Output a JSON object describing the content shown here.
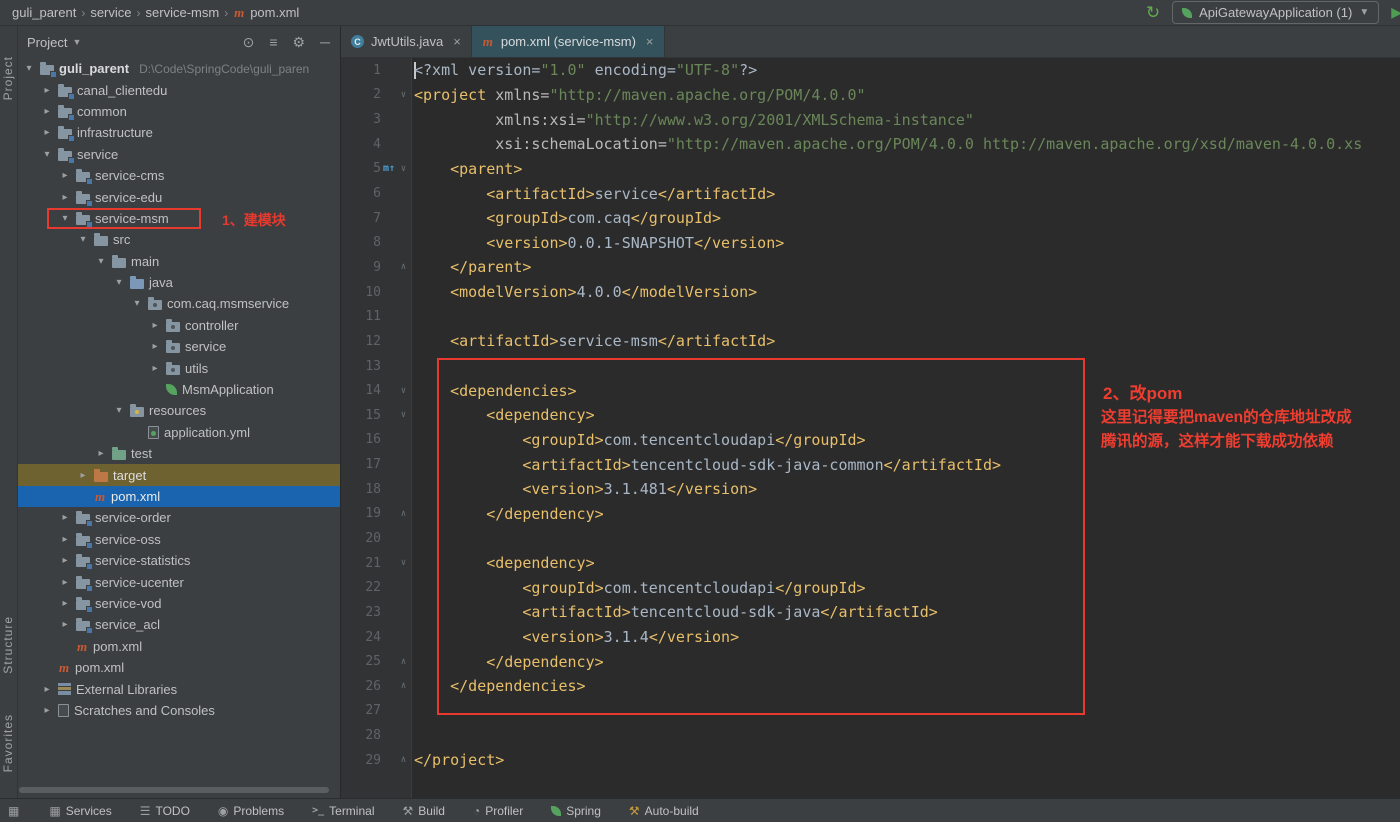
{
  "breadcrumbs": {
    "items": [
      {
        "label": "guli_parent"
      },
      {
        "label": "service"
      },
      {
        "label": "service-msm"
      },
      {
        "label": "pom.xml",
        "icon": "maven"
      }
    ]
  },
  "run": {
    "config": "ApiGatewayApplication (1)"
  },
  "stripe": {
    "project": "Project",
    "structure": "Structure",
    "favorites": "Favorites"
  },
  "panel": {
    "title": "Project",
    "toolbar_icons": [
      "locate",
      "collapse-all",
      "settings",
      "hide"
    ]
  },
  "tabs": [
    {
      "label": "JwtUtils.java",
      "icon": "java-class",
      "active": false
    },
    {
      "label": "pom.xml (service-msm)",
      "icon": "maven",
      "active": true
    }
  ],
  "tree": [
    {
      "label": "guli_parent",
      "path": "D:\\Code\\SpringCode\\guli_paren",
      "lv": 0,
      "ch": "open",
      "icon": "module",
      "bold": true
    },
    {
      "label": "canal_clientedu",
      "lv": 1,
      "ch": "closed",
      "icon": "module"
    },
    {
      "label": "common",
      "lv": 1,
      "ch": "closed",
      "icon": "module"
    },
    {
      "label": "infrastructure",
      "lv": 1,
      "ch": "closed",
      "icon": "module"
    },
    {
      "label": "service",
      "lv": 1,
      "ch": "open",
      "icon": "module"
    },
    {
      "label": "service-cms",
      "lv": 2,
      "ch": "closed",
      "icon": "module"
    },
    {
      "label": "service-edu",
      "lv": 2,
      "ch": "closed",
      "icon": "module"
    },
    {
      "label": "service-msm",
      "lv": 2,
      "ch": "open",
      "icon": "module",
      "box": true,
      "note": "1、建模块"
    },
    {
      "label": "src",
      "lv": 3,
      "ch": "open",
      "icon": "folder"
    },
    {
      "label": "main",
      "lv": 4,
      "ch": "open",
      "icon": "folder"
    },
    {
      "label": "java",
      "lv": 5,
      "ch": "open",
      "icon": "folder-src"
    },
    {
      "label": "com.caq.msmservice",
      "lv": 6,
      "ch": "open",
      "icon": "package"
    },
    {
      "label": "controller",
      "lv": 7,
      "ch": "closed",
      "icon": "package"
    },
    {
      "label": "service",
      "lv": 7,
      "ch": "closed",
      "icon": "package"
    },
    {
      "label": "utils",
      "lv": 7,
      "ch": "closed",
      "icon": "package"
    },
    {
      "label": "MsmApplication",
      "lv": 7,
      "ch": "",
      "icon": "spring-class"
    },
    {
      "label": "resources",
      "lv": 5,
      "ch": "open",
      "icon": "folder-res"
    },
    {
      "label": "application.yml",
      "lv": 6,
      "ch": "",
      "icon": "yml"
    },
    {
      "label": "test",
      "lv": 4,
      "ch": "closed",
      "icon": "folder-test"
    },
    {
      "label": "target",
      "lv": 3,
      "ch": "closed",
      "icon": "folder-target",
      "sel": "amber"
    },
    {
      "label": "pom.xml",
      "lv": 3,
      "ch": "",
      "icon": "maven",
      "sel": "blue"
    },
    {
      "label": "service-order",
      "lv": 2,
      "ch": "closed",
      "icon": "module"
    },
    {
      "label": "service-oss",
      "lv": 2,
      "ch": "closed",
      "icon": "module"
    },
    {
      "label": "service-statistics",
      "lv": 2,
      "ch": "closed",
      "icon": "module"
    },
    {
      "label": "service-ucenter",
      "lv": 2,
      "ch": "closed",
      "icon": "module"
    },
    {
      "label": "service-vod",
      "lv": 2,
      "ch": "closed",
      "icon": "module"
    },
    {
      "label": "service_acl",
      "lv": 2,
      "ch": "closed",
      "icon": "module"
    },
    {
      "label": "pom.xml",
      "lv": 2,
      "ch": "",
      "icon": "maven"
    },
    {
      "label": "pom.xml",
      "lv": 1,
      "ch": "",
      "icon": "maven"
    },
    {
      "label": "External Libraries",
      "lv": 1,
      "ch": "closed",
      "icon": "lib"
    },
    {
      "label": "Scratches and Consoles",
      "lv": 1,
      "ch": "closed",
      "icon": "scratch"
    }
  ],
  "editor": {
    "lines": [
      {
        "f": "",
        "b": false,
        "c": true,
        "t": [
          [
            "p",
            "<?xml version="
          ],
          [
            "s",
            "\"1.0\""
          ],
          [
            "p",
            " encoding="
          ],
          [
            "s",
            "\"UTF-8\""
          ],
          [
            "p",
            "?>"
          ]
        ]
      },
      {
        "f": "v",
        "b": false,
        "t": [
          [
            "t",
            "<project"
          ],
          [
            "p",
            " "
          ],
          [
            "a",
            "xmlns="
          ],
          [
            "s",
            "\"http://maven.apache.org/POM/4.0.0\""
          ]
        ]
      },
      {
        "f": "",
        "b": false,
        "t": [
          [
            "p",
            "         "
          ],
          [
            "a",
            "xmlns:xsi="
          ],
          [
            "s",
            "\"http://www.w3.org/2001/XMLSchema-instance\""
          ]
        ]
      },
      {
        "f": "",
        "b": false,
        "t": [
          [
            "p",
            "         "
          ],
          [
            "a",
            "xsi:schemaLocation="
          ],
          [
            "s",
            "\"http://maven.apache.org/POM/4.0.0 http://maven.apache.org/xsd/maven-4.0.0.xs"
          ]
        ]
      },
      {
        "f": "v",
        "b": true,
        "t": [
          [
            "p",
            "    "
          ],
          [
            "t",
            "<parent>"
          ]
        ]
      },
      {
        "f": "",
        "b": false,
        "t": [
          [
            "p",
            "        "
          ],
          [
            "t",
            "<artifactId>"
          ],
          [
            "p",
            "service"
          ],
          [
            "t",
            "</artifactId>"
          ]
        ]
      },
      {
        "f": "",
        "b": false,
        "t": [
          [
            "p",
            "        "
          ],
          [
            "t",
            "<groupId>"
          ],
          [
            "p",
            "com.caq"
          ],
          [
            "t",
            "</groupId>"
          ]
        ]
      },
      {
        "f": "",
        "b": false,
        "t": [
          [
            "p",
            "        "
          ],
          [
            "t",
            "<version>"
          ],
          [
            "p",
            "0.0.1-SNAPSHOT"
          ],
          [
            "t",
            "</version>"
          ]
        ]
      },
      {
        "f": "^",
        "b": false,
        "t": [
          [
            "p",
            "    "
          ],
          [
            "t",
            "</parent>"
          ]
        ]
      },
      {
        "f": "",
        "b": false,
        "t": [
          [
            "p",
            "    "
          ],
          [
            "t",
            "<modelVersion>"
          ],
          [
            "p",
            "4.0.0"
          ],
          [
            "t",
            "</modelVersion>"
          ]
        ]
      },
      {
        "f": "",
        "b": false,
        "t": []
      },
      {
        "f": "",
        "b": false,
        "t": [
          [
            "p",
            "    "
          ],
          [
            "t",
            "<artifactId>"
          ],
          [
            "p",
            "service-msm"
          ],
          [
            "t",
            "</artifactId>"
          ]
        ]
      },
      {
        "f": "",
        "b": false,
        "t": []
      },
      {
        "f": "v",
        "b": false,
        "t": [
          [
            "p",
            "    "
          ],
          [
            "t",
            "<dependencies>"
          ]
        ]
      },
      {
        "f": "v",
        "b": false,
        "t": [
          [
            "p",
            "        "
          ],
          [
            "t",
            "<dependency>"
          ]
        ]
      },
      {
        "f": "",
        "b": false,
        "t": [
          [
            "p",
            "            "
          ],
          [
            "t",
            "<groupId>"
          ],
          [
            "p",
            "com.tencentcloudapi"
          ],
          [
            "t",
            "</groupId>"
          ]
        ]
      },
      {
        "f": "",
        "b": false,
        "t": [
          [
            "p",
            "            "
          ],
          [
            "t",
            "<artifactId>"
          ],
          [
            "p",
            "tencentcloud-sdk-java-common"
          ],
          [
            "t",
            "</artifactId>"
          ]
        ]
      },
      {
        "f": "",
        "b": false,
        "t": [
          [
            "p",
            "            "
          ],
          [
            "t",
            "<version>"
          ],
          [
            "p",
            "3.1.481"
          ],
          [
            "t",
            "</version>"
          ]
        ]
      },
      {
        "f": "^",
        "b": false,
        "t": [
          [
            "p",
            "        "
          ],
          [
            "t",
            "</dependency>"
          ]
        ]
      },
      {
        "f": "",
        "b": false,
        "t": []
      },
      {
        "f": "v",
        "b": false,
        "t": [
          [
            "p",
            "        "
          ],
          [
            "t",
            "<dependency>"
          ]
        ]
      },
      {
        "f": "",
        "b": false,
        "t": [
          [
            "p",
            "            "
          ],
          [
            "t",
            "<groupId>"
          ],
          [
            "p",
            "com.tencentcloudapi"
          ],
          [
            "t",
            "</groupId>"
          ]
        ]
      },
      {
        "f": "",
        "b": false,
        "t": [
          [
            "p",
            "            "
          ],
          [
            "t",
            "<artifactId>"
          ],
          [
            "p",
            "tencentcloud-sdk-java"
          ],
          [
            "t",
            "</artifactId>"
          ]
        ]
      },
      {
        "f": "",
        "b": false,
        "t": [
          [
            "p",
            "            "
          ],
          [
            "t",
            "<version>"
          ],
          [
            "p",
            "3.1.4"
          ],
          [
            "t",
            "</version>"
          ]
        ]
      },
      {
        "f": "^",
        "b": false,
        "t": [
          [
            "p",
            "        "
          ],
          [
            "t",
            "</dependency>"
          ]
        ]
      },
      {
        "f": "^",
        "b": false,
        "t": [
          [
            "p",
            "    "
          ],
          [
            "t",
            "</dependencies>"
          ]
        ]
      },
      {
        "f": "",
        "b": false,
        "t": []
      },
      {
        "f": "",
        "b": false,
        "t": []
      },
      {
        "f": "^",
        "b": false,
        "t": [
          [
            "t",
            "</project>"
          ]
        ]
      }
    ]
  },
  "annotations": {
    "pom_note_title": "2、改pom",
    "pom_note_line1": "这里记得要把maven的仓库地址改成",
    "pom_note_line2": "腾讯的源，这样才能下载成功依赖"
  },
  "status": {
    "items": [
      {
        "label": "Services",
        "icon": "services"
      },
      {
        "label": "TODO",
        "icon": "todo"
      },
      {
        "label": "Problems",
        "icon": "problems"
      },
      {
        "label": "Terminal",
        "icon": "terminal"
      },
      {
        "label": "Build",
        "icon": "build"
      },
      {
        "label": "Profiler",
        "icon": "profiler"
      },
      {
        "label": "Spring",
        "icon": "spring"
      },
      {
        "label": "Auto-build",
        "icon": "auto-build"
      }
    ]
  },
  "colors": {
    "accent_red": "#e8392e",
    "selection_blue": "#1a63ae",
    "selection_amber": "#6e6230",
    "tag_yellow": "#e8bf6a",
    "string_green": "#6a8759",
    "maven_orange": "#cb5a32",
    "spring_green": "#56a25f"
  }
}
